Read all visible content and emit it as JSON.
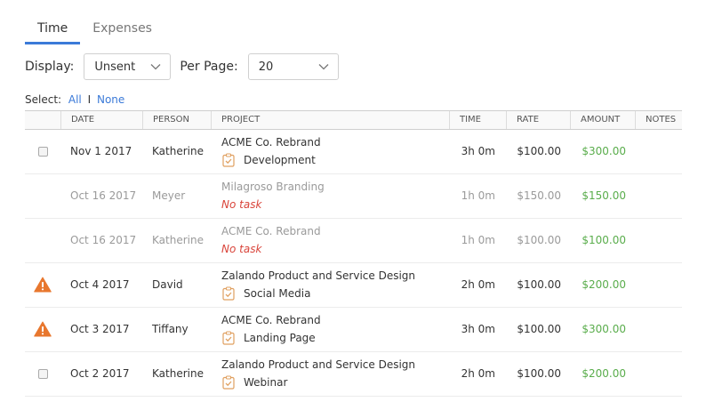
{
  "tabs": [
    {
      "label": "Time",
      "active": true
    },
    {
      "label": "Expenses",
      "active": false
    }
  ],
  "filters": {
    "display_label": "Display:",
    "display_value": "Unsent",
    "per_page_label": "Per Page:",
    "per_page_value": "20"
  },
  "select": {
    "label": "Select:",
    "all": "All",
    "separator": "I",
    "none": "None"
  },
  "table": {
    "headers": [
      "DATE",
      "PERSON",
      "PROJECT",
      "TIME",
      "RATE",
      "AMOUNT",
      "NOTES"
    ],
    "rows": [
      {
        "marker": "checkbox",
        "date": "Nov 1 2017",
        "person": "Katherine",
        "project": "ACME Co. Rebrand",
        "task": "Development",
        "time": "3h 0m",
        "rate": "$100.00",
        "amount": "$300.00",
        "dimmed": false
      },
      {
        "marker": "none",
        "date": "Oct 16 2017",
        "person": "Meyer",
        "project": "Milagroso Branding",
        "task": "No task",
        "time": "1h 0m",
        "rate": "$150.00",
        "amount": "$150.00",
        "dimmed": true
      },
      {
        "marker": "none",
        "date": "Oct 16 2017",
        "person": "Katherine",
        "project": "ACME Co. Rebrand",
        "task": "No task",
        "time": "1h 0m",
        "rate": "$100.00",
        "amount": "$100.00",
        "dimmed": true
      },
      {
        "marker": "warning",
        "date": "Oct 4 2017",
        "person": "David",
        "project": "Zalando Product and Service Design",
        "task": "Social Media",
        "time": "2h 0m",
        "rate": "$100.00",
        "amount": "$200.00",
        "dimmed": false
      },
      {
        "marker": "warning",
        "date": "Oct 3 2017",
        "person": "Tiffany",
        "project": "ACME Co. Rebrand",
        "task": "Landing Page",
        "time": "3h 0m",
        "rate": "$100.00",
        "amount": "$300.00",
        "dimmed": false
      },
      {
        "marker": "checkbox",
        "date": "Oct 2 2017",
        "person": "Katherine",
        "project": "Zalando Product and Service Design",
        "task": "Webinar",
        "time": "2h 0m",
        "rate": "$100.00",
        "amount": "$200.00",
        "dimmed": false
      }
    ]
  },
  "colors": {
    "accent": "#3b7ad8",
    "amount": "#5aad4c",
    "no_task": "#d9443a",
    "warning": "#e8772e",
    "task_icon": "#e0a060"
  },
  "icons": {
    "marker_checkbox": "checkbox",
    "marker_warning": "warning-icon",
    "task": "clipboard-check-icon",
    "dropdown": "chevron-down-icon"
  }
}
